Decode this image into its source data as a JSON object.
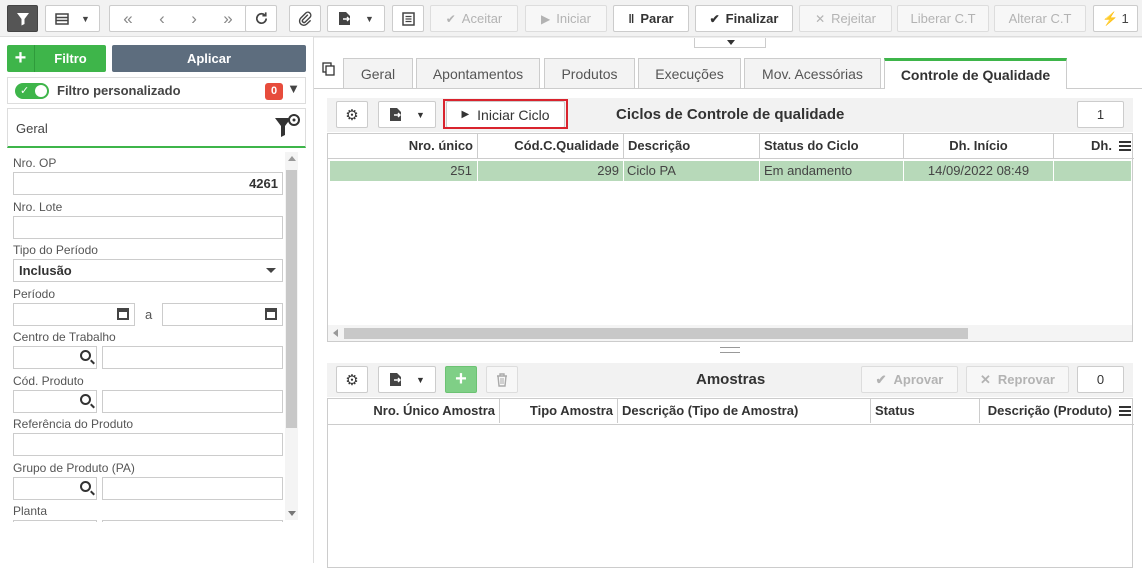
{
  "toolbar": {
    "aceitar": "Aceitar",
    "iniciar": "Iniciar",
    "parar": "Parar",
    "finalizar": "Finalizar",
    "rejeitar": "Rejeitar",
    "liberar": "Liberar C.T",
    "alterar": "Alterar C.T",
    "flash_count": "1"
  },
  "filter": {
    "filtro_label": "Filtro",
    "aplicar_label": "Aplicar",
    "personalizado_label": "Filtro personalizado",
    "personalizado_count": "0",
    "section_title": "Geral",
    "fields": {
      "nro_op_label": "Nro. OP",
      "nro_op_value": "4261",
      "nro_lote_label": "Nro. Lote",
      "tipo_periodo_label": "Tipo do Período",
      "tipo_periodo_value": "Inclusão",
      "periodo_label": "Período",
      "periodo_sep": "a",
      "centro_label": "Centro de Trabalho",
      "cod_produto_label": "Cód. Produto",
      "referencia_label": "Referência do Produto",
      "grupo_label": "Grupo de Produto (PA)",
      "planta_label": "Planta"
    }
  },
  "tabs": [
    "Geral",
    "Apontamentos",
    "Produtos",
    "Execuções",
    "Mov. Acessórias",
    "Controle de Qualidade"
  ],
  "ciclos": {
    "iniciar_ciclo_label": "Iniciar Ciclo",
    "title": "Ciclos de Controle de qualidade",
    "count": "1",
    "columns": [
      "Nro. único",
      "Cód.C.Qualidade",
      "Descrição",
      "Status do Ciclo",
      "Dh. Início",
      "Dh."
    ],
    "rows": [
      {
        "nro_unico": "251",
        "cod_qualidade": "299",
        "descricao": "Ciclo PA",
        "status": "Em andamento",
        "dh_inicio": "14/09/2022 08:49"
      }
    ]
  },
  "amostras": {
    "title": "Amostras",
    "aprovar_label": "Aprovar",
    "reprovar_label": "Reprovar",
    "count": "0",
    "columns": [
      "Nro. Único Amostra",
      "Tipo Amostra",
      "Descrição (Tipo de Amostra)",
      "Status",
      "Descrição (Produto)"
    ]
  }
}
